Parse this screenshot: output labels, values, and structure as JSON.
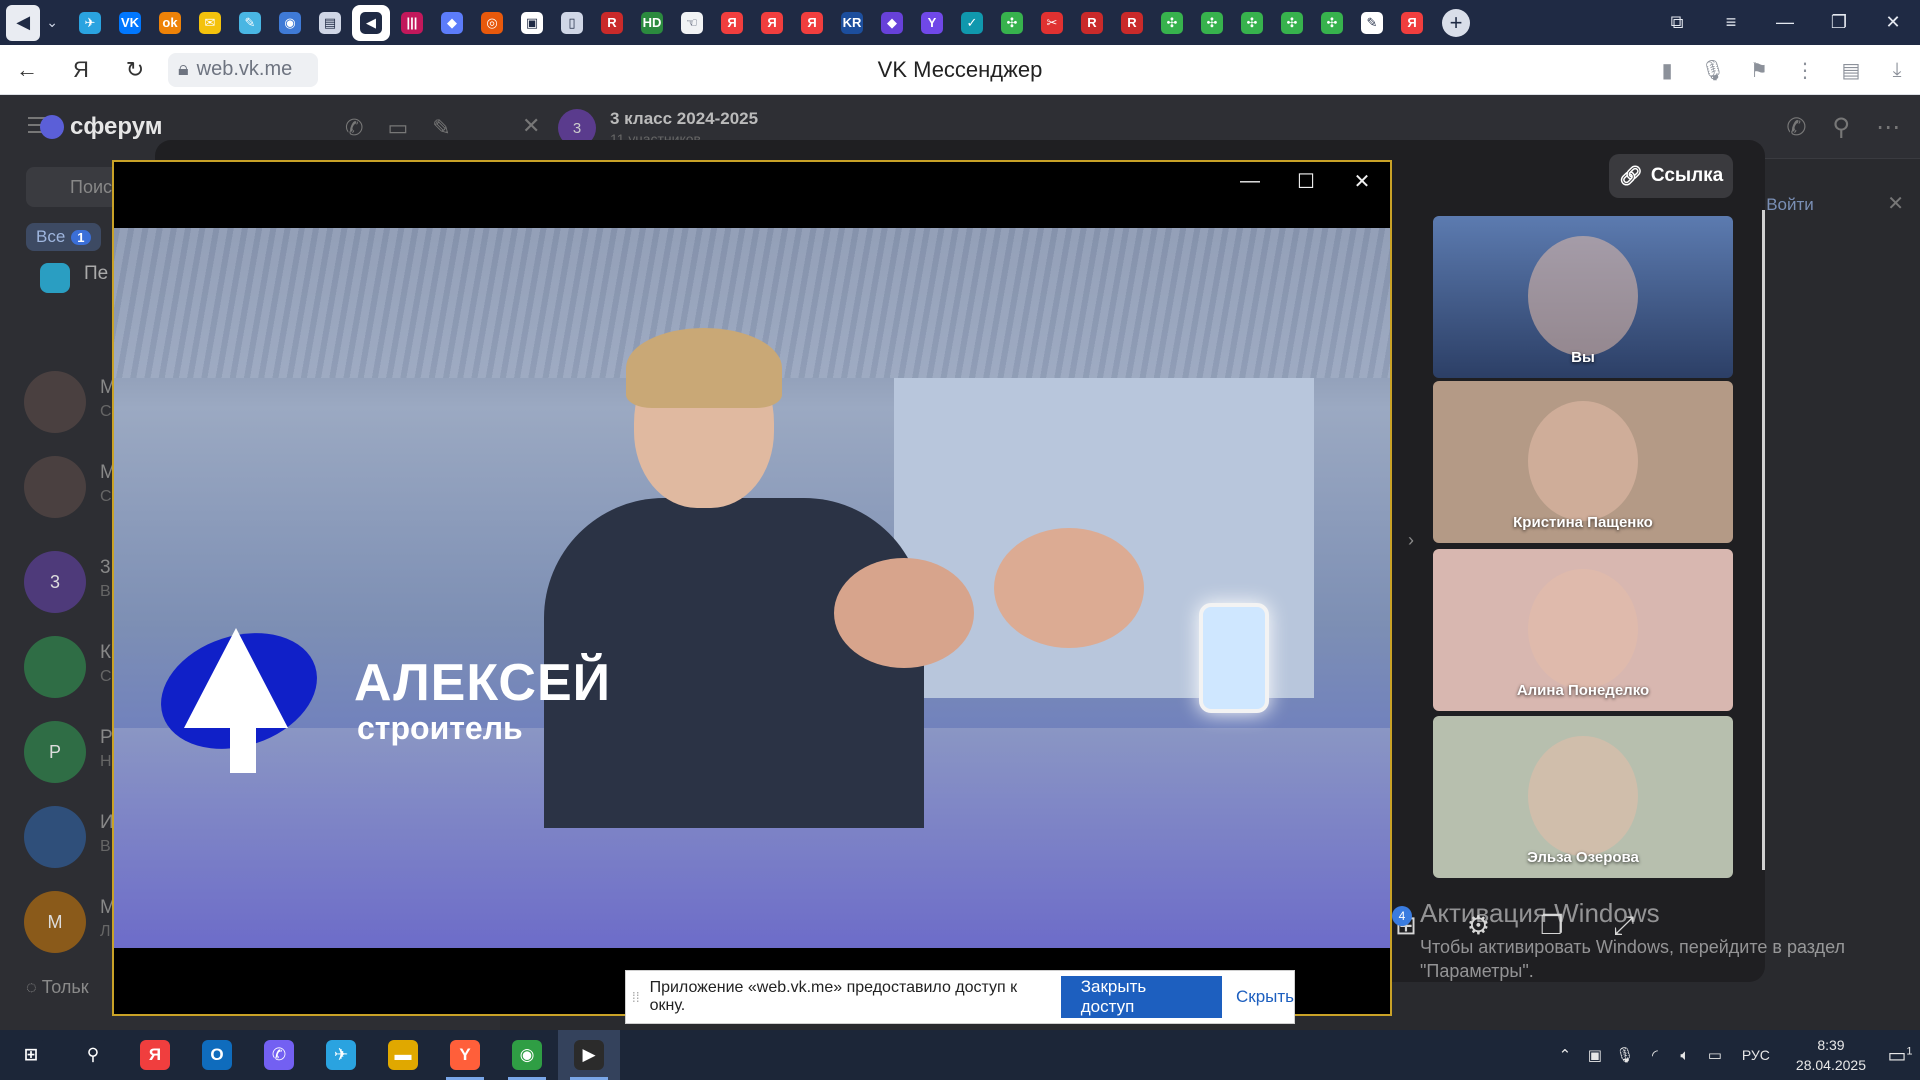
{
  "browser": {
    "page_title": "VK Мессенджер",
    "url": "web.vk.me",
    "pinned_tabs": [
      {
        "icon": "telegram-icon",
        "color": "#2aa3e0",
        "glyph": "✈"
      },
      {
        "icon": "vk-icon",
        "color": "#0077ff",
        "glyph": "VK"
      },
      {
        "icon": "odnoklassniki-icon",
        "color": "#ee8208",
        "glyph": "ok"
      },
      {
        "icon": "mail-icon",
        "color": "#f4c20d",
        "glyph": "✉"
      },
      {
        "icon": "pen-icon",
        "color": "#49b6e3",
        "glyph": "✎"
      },
      {
        "icon": "game-icon",
        "color": "#3f7ad6",
        "glyph": "◉"
      },
      {
        "icon": "document-icon",
        "color": "#cfd6e6",
        "glyph": "▤"
      },
      {
        "icon": "sound-icon",
        "color": "#1f2a44",
        "glyph": "◀"
      },
      {
        "icon": "music-icon",
        "color": "#c2185b",
        "glyph": "|||"
      },
      {
        "icon": "cube-icon",
        "color": "#5c7cfa",
        "glyph": "◆"
      },
      {
        "icon": "sphere-icon",
        "color": "#e8590c",
        "glyph": "◎"
      },
      {
        "icon": "notes-icon",
        "color": "#ffffff",
        "glyph": "▣"
      },
      {
        "icon": "file-icon",
        "color": "#cfd6e6",
        "glyph": "▯"
      },
      {
        "icon": "r-icon",
        "color": "#c92a2a",
        "glyph": "R"
      },
      {
        "icon": "hd-icon",
        "color": "#2b8a3e",
        "glyph": "HD"
      },
      {
        "icon": "hand-icon",
        "color": "#f1f3f5",
        "glyph": "☜"
      },
      {
        "icon": "yandex-icon",
        "color": "#f03e3e",
        "glyph": "Я"
      },
      {
        "icon": "yandex-icon",
        "color": "#f03e3e",
        "glyph": "Я"
      },
      {
        "icon": "yandex-icon",
        "color": "#f03e3e",
        "glyph": "Я"
      },
      {
        "icon": "kr-icon",
        "color": "#1c4e9d",
        "glyph": "KR"
      },
      {
        "icon": "shield-icon",
        "color": "#6741d9",
        "glyph": "◆"
      },
      {
        "icon": "y-letter-icon",
        "color": "#7048e8",
        "glyph": "Y"
      },
      {
        "icon": "check-icon",
        "color": "#1098ad",
        "glyph": "✓"
      },
      {
        "icon": "molecule-icon",
        "color": "#37b24d",
        "glyph": "✣"
      },
      {
        "icon": "scissors-icon",
        "color": "#e03131",
        "glyph": "✂"
      },
      {
        "icon": "r-icon",
        "color": "#c92a2a",
        "glyph": "R"
      },
      {
        "icon": "r-icon",
        "color": "#c92a2a",
        "glyph": "R"
      },
      {
        "icon": "molecule-icon",
        "color": "#37b24d",
        "glyph": "✣"
      },
      {
        "icon": "molecule-icon",
        "color": "#37b24d",
        "glyph": "✣"
      },
      {
        "icon": "molecule-icon",
        "color": "#37b24d",
        "glyph": "✣"
      },
      {
        "icon": "molecule-icon",
        "color": "#37b24d",
        "glyph": "✣"
      },
      {
        "icon": "molecule-icon",
        "color": "#37b24d",
        "glyph": "✣"
      },
      {
        "icon": "pencil-icon",
        "color": "#ffffff",
        "glyph": "✎"
      },
      {
        "icon": "yandex-icon",
        "color": "#f03e3e",
        "glyph": "Я"
      }
    ]
  },
  "sidebar": {
    "logo": "сферум",
    "search_placeholder": "Поис",
    "filter_tab": {
      "label": "Все",
      "count": "1"
    },
    "pinned_label": "Пе",
    "rows": [
      {
        "avatar": "",
        "name": "М",
        "sub": "С",
        "color": "#4a4040"
      },
      {
        "avatar": "",
        "name": "М",
        "sub": "С",
        "color": "#4a4040"
      },
      {
        "avatar": "3",
        "name": "3",
        "sub": "В",
        "color": "#4e3a7a"
      },
      {
        "avatar": "",
        "name": "К",
        "sub": "С",
        "color": "#2f6d45"
      },
      {
        "avatar": "Р",
        "name": "Р",
        "sub": "Н",
        "color": "#2f6d45"
      },
      {
        "avatar": "",
        "name": "И",
        "sub": "В",
        "color": "#2f4f7a"
      },
      {
        "avatar": "М",
        "name": "М",
        "sub": "Л",
        "color": "#8a5a1a"
      }
    ],
    "bottom_label": "Тольк"
  },
  "chat": {
    "avatar": "3",
    "title": "3 класс 2024-2025",
    "subtitle": "11 участников",
    "join_label": "Войти"
  },
  "call": {
    "link_label": "Ссылка",
    "tiles": [
      {
        "name": "Вы",
        "bg": "#3a5a8c"
      },
      {
        "name": "Кристина Пащенко",
        "bg": "#b49a86"
      },
      {
        "name": "Алина Понеделко",
        "bg": "#d8b7b0"
      },
      {
        "name": "Эльза Озерова",
        "bg": "#b7bfae"
      }
    ],
    "bottom_badge": "4"
  },
  "video": {
    "caption_name": "АЛЕКСЕЙ",
    "caption_role": "строитель"
  },
  "share_notice": {
    "text": "Приложение «web.vk.me» предоставило доступ к окну.",
    "stop_label": "Закрыть доступ",
    "hide_label": "Скрыть"
  },
  "watermark": {
    "title": "Активация Windows",
    "line1": "Чтобы активировать Windows, перейдите в раздел",
    "line2": "\"Параметры\"."
  },
  "taskbar": {
    "apps": [
      {
        "icon": "windows-start-icon",
        "color": "#1c2638",
        "glyph": "⊞"
      },
      {
        "icon": "search-icon",
        "color": "#1c2638",
        "glyph": "⚲"
      },
      {
        "icon": "yandex-icon",
        "color": "#f03e3e",
        "glyph": "Я"
      },
      {
        "icon": "outlook-icon",
        "color": "#0f6cbd",
        "glyph": "O"
      },
      {
        "icon": "viber-icon",
        "color": "#7360f2",
        "glyph": "✆"
      },
      {
        "icon": "telegram-icon",
        "color": "#2aa3e0",
        "glyph": "✈"
      },
      {
        "icon": "folder-icon",
        "color": "#e0a800",
        "glyph": "▬"
      },
      {
        "icon": "yandex-browser-icon",
        "color": "#ff5f3a",
        "glyph": "Y"
      },
      {
        "icon": "chrome-icon",
        "color": "#2f9e44",
        "glyph": "◉"
      },
      {
        "icon": "media-player-icon",
        "color": "#2b2b2b",
        "glyph": "▶"
      }
    ],
    "language": "РУС",
    "time": "8:39",
    "date": "28.04.2025",
    "notification_count": "1"
  }
}
